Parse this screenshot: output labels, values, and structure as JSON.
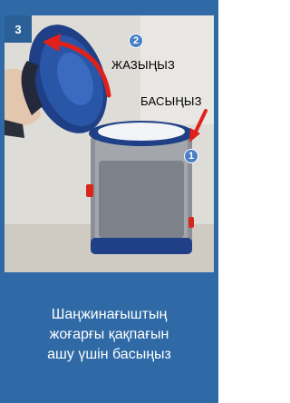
{
  "step": {
    "number": "3"
  },
  "labels": {
    "close": "ЖАЗЫҢЫЗ",
    "press": "БАСЫҢЫЗ"
  },
  "markers": {
    "marker_1": "1",
    "marker_2": "2"
  },
  "caption": {
    "lines": [
      "Шаңжинағыштың",
      "жоғарғы қақпағын",
      "ашу үшін басыңыз"
    ]
  },
  "colors": {
    "panel_blue": "#2f6aa6",
    "arrow_red": "#e0211b",
    "marker_blue": "#4a7fc4"
  },
  "icons": {
    "curved_arrow": "curved-arrow-icon",
    "press_arrow": "diagonal-arrow-icon"
  }
}
